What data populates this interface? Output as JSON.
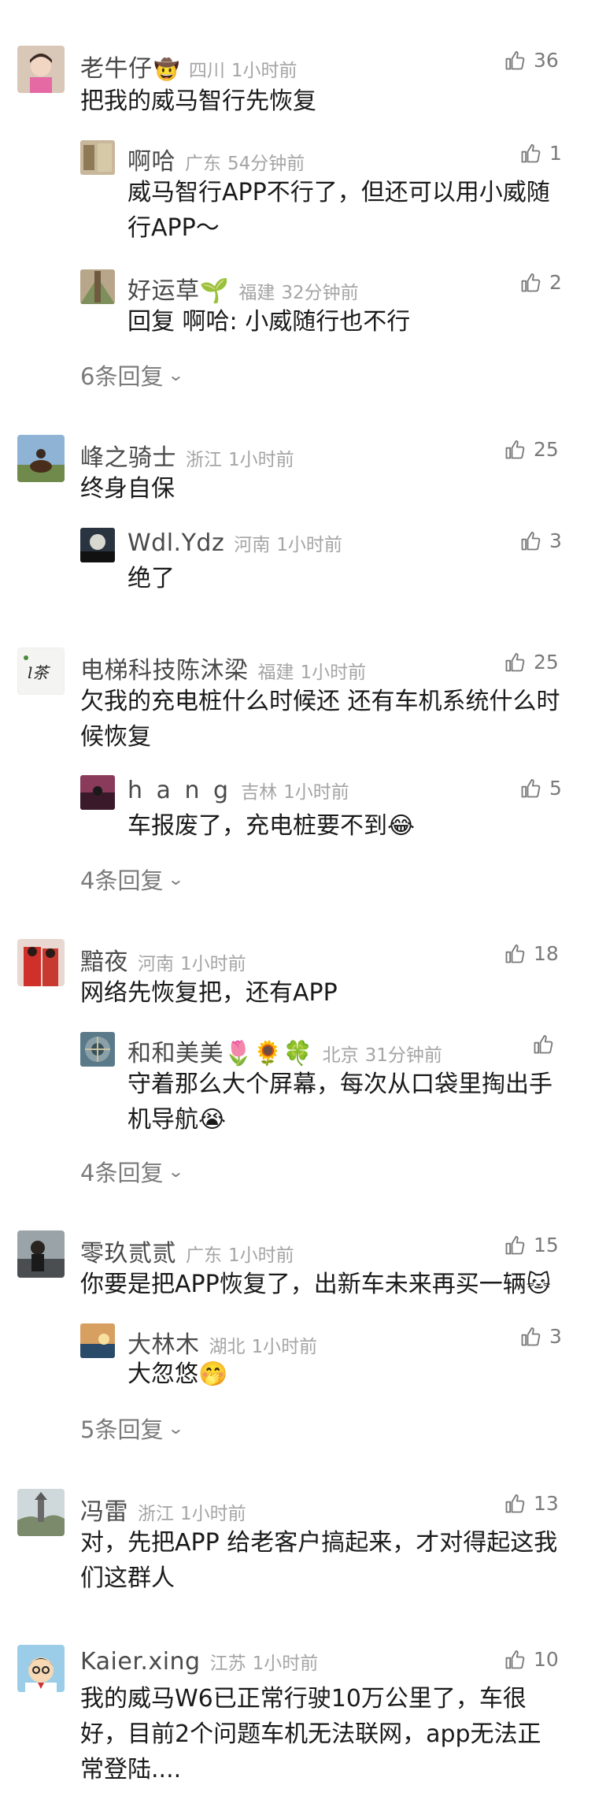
{
  "comments": [
    {
      "name": "老牛仔",
      "badge": "🤠",
      "location": "四川",
      "time": "1小时前",
      "likes": "36",
      "text": "把我的威马智行先恢复",
      "replies": [
        {
          "name": "啊哈",
          "location": "广东",
          "time": "54分钟前",
          "likes": "1",
          "text": "威马智行APP不行了，但还可以用小威随行APP～"
        },
        {
          "name": "好运草🌱",
          "location": "福建",
          "time": "32分钟前",
          "likes": "2",
          "prefix": "回复 ",
          "at": "啊哈",
          "text": ": 小威随行也不行"
        }
      ],
      "more": "6条回复"
    },
    {
      "name": "峰之骑士",
      "location": "浙江",
      "time": "1小时前",
      "likes": "25",
      "text": "终身自保",
      "replies": [
        {
          "name": "Wdl.Ydz",
          "location": "河南",
          "time": "1小时前",
          "likes": "3",
          "text": "绝了"
        }
      ]
    },
    {
      "name": "电梯科技陈沐梁",
      "location": "福建",
      "time": "1小时前",
      "likes": "25",
      "text": "欠我的充电桩什么时候还  还有车机系统什么时候恢复",
      "replies": [
        {
          "name": "h a n g",
          "location": "吉林",
          "time": "1小时前",
          "likes": "5",
          "text": "车报废了，充电桩要不到😂"
        }
      ],
      "more": "4条回复"
    },
    {
      "name": "黯夜",
      "location": "河南",
      "time": "1小时前",
      "likes": "18",
      "text": "网络先恢复把，还有APP",
      "replies": [
        {
          "name": "和和美美🌷🌻🍀",
          "location": "北京",
          "time": "31分钟前",
          "likes": "",
          "text": "守着那么大个屏幕，每次从口袋里掏出手机导航😭"
        }
      ],
      "more": "4条回复"
    },
    {
      "name": "零玖贰贰",
      "location": "广东",
      "time": "1小时前",
      "likes": "15",
      "text": "你要是把APP恢复了，出新车未来再买一辆🐱",
      "replies": [
        {
          "name": "大林木",
          "location": "湖北",
          "time": "1小时前",
          "likes": "3",
          "text": "大忽悠🤭"
        }
      ],
      "more": "5条回复"
    },
    {
      "name": "冯雷",
      "location": "浙江",
      "time": "1小时前",
      "likes": "13",
      "text": "对，先把APP 给老客户搞起来，才对得起这我们这群人",
      "replies": []
    },
    {
      "name": "Kaier.xing",
      "location": "江苏",
      "time": "1小时前",
      "likes": "10",
      "text": "我的威马W6已正常行驶10万公里了，车很好，目前2个问题车机无法联网，app无法正常登陆....",
      "replies": []
    }
  ],
  "colors": {
    "name": "#4a4a4a",
    "meta": "#a5a5a5",
    "text": "#1a1a1a",
    "icon": "#7a7a7a"
  }
}
